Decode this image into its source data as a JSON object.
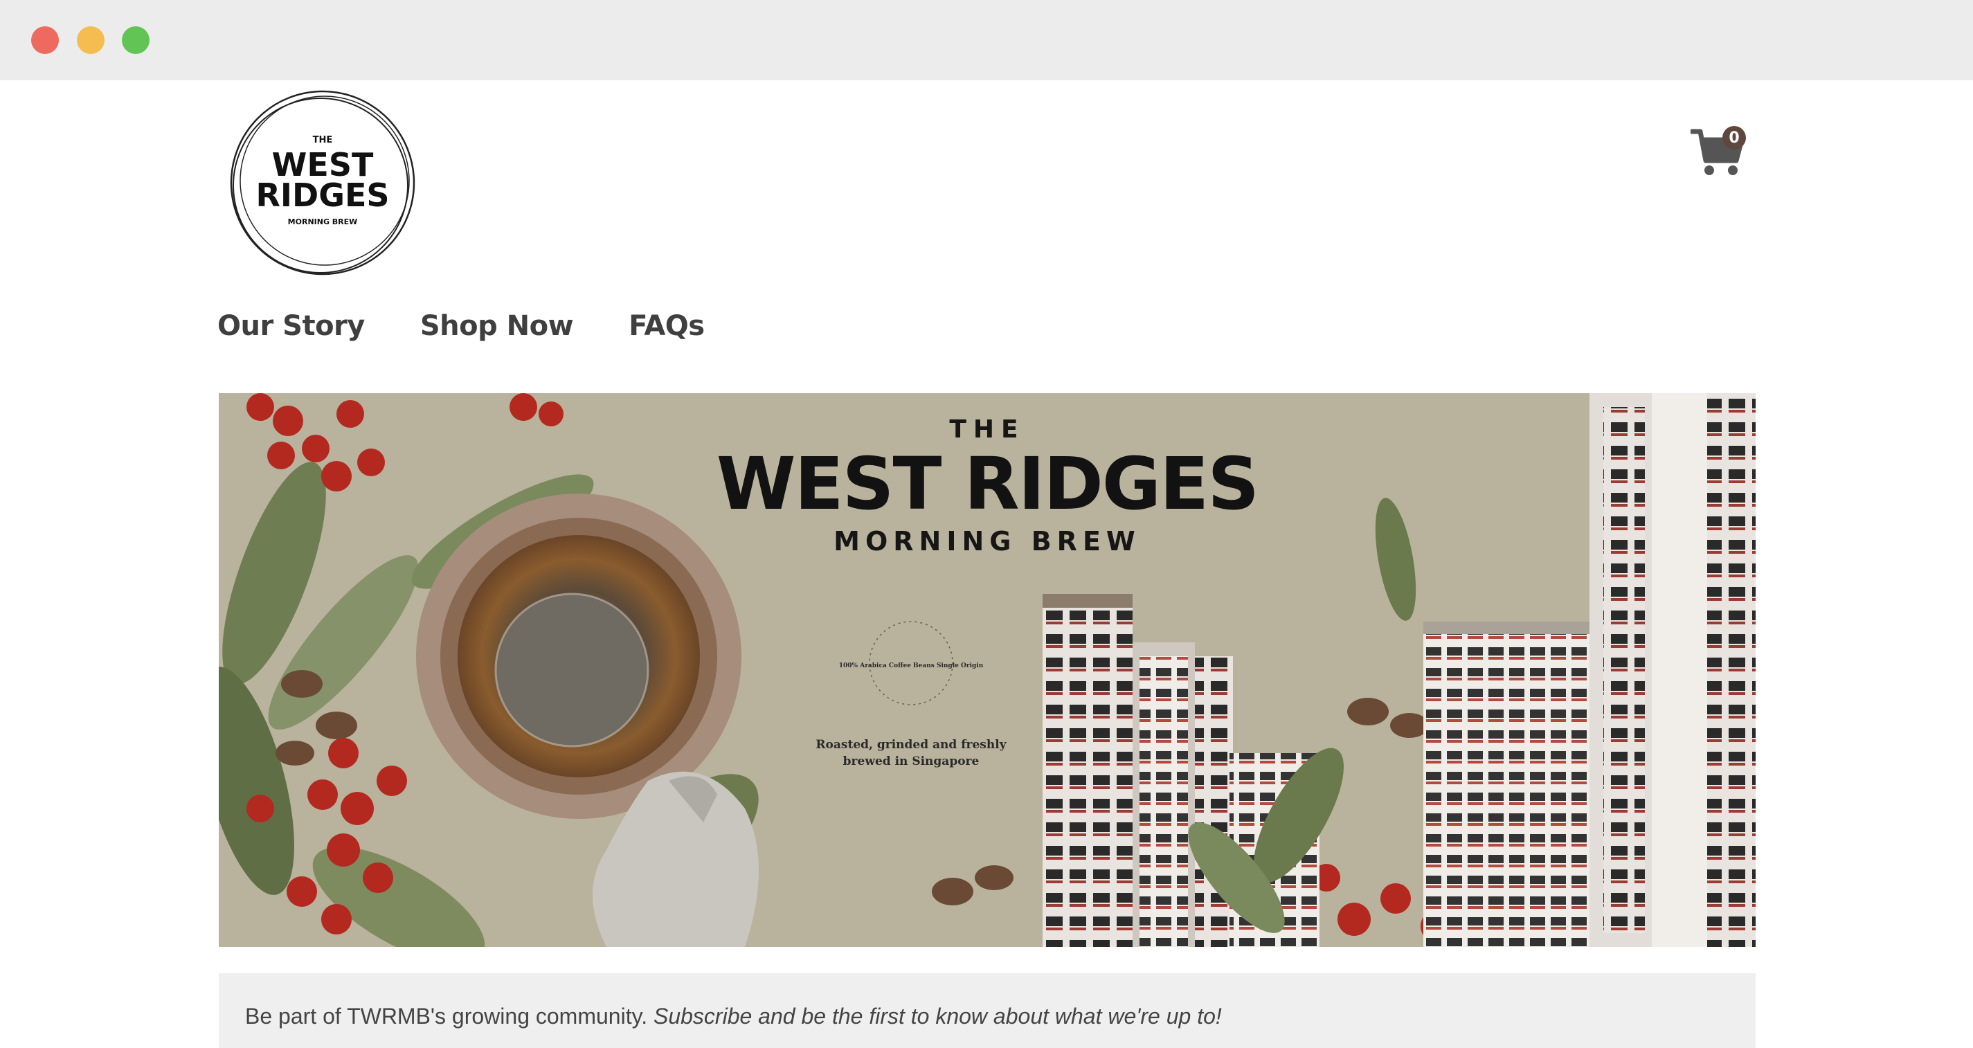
{
  "window": {
    "controls": [
      "close",
      "minimize",
      "zoom"
    ]
  },
  "header": {
    "logo": {
      "line1": "THE",
      "line2": "WEST",
      "line3": "RIDGES",
      "line4": "MORNING BREW"
    },
    "cart": {
      "icon": "shopping-cart-icon",
      "count": "0"
    }
  },
  "nav": {
    "items": [
      {
        "label": "Our Story"
      },
      {
        "label": "Shop Now"
      },
      {
        "label": "FAQs"
      }
    ]
  },
  "hero": {
    "the": "THE",
    "title": "WEST RIDGES",
    "subtitle": "MORNING BREW",
    "circle_text": "100% Arabica Coffee Beans Single Origin",
    "caption": "Roasted, grinded and freshly\nbrewed in Singapore"
  },
  "subscribe": {
    "text": "Be part of TWRMB's growing community.",
    "emphasis": "Subscribe and be the first to know about what we're up to!"
  },
  "colors": {
    "titlebar": "#ececec",
    "nav_text": "#3f3f3f",
    "cart": "#555555",
    "cart_badge": "#5e473d",
    "hero_bg": "#b9b39d",
    "subscribe_bg": "#efefef"
  }
}
